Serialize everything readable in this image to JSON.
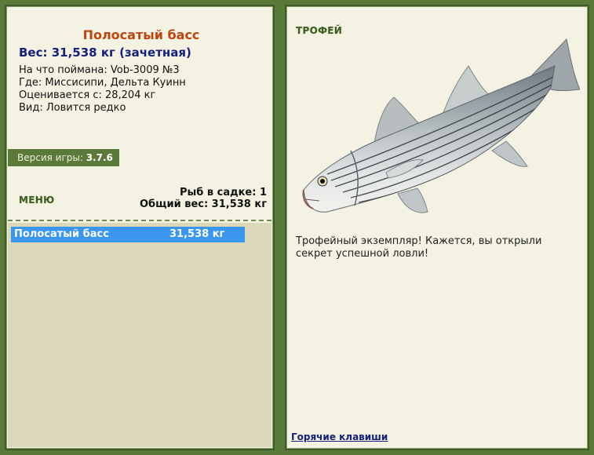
{
  "fish": {
    "title": "Полосатый басс",
    "weight_line": "Вес: 31,538 кг (зачетная)",
    "bait_line": "На что поймана: Vob-3009 №3",
    "where_line": "Где: Миссисипи, Дельта Куинн",
    "price_line": "Оценивается с: 28,204 кг",
    "kind_line": "Вид: Ловится редко"
  },
  "version": {
    "label": "Версия игры:",
    "value": "3.7.6"
  },
  "menu": {
    "label": "МЕНЮ"
  },
  "keep": {
    "count_line": "Рыб в садке: 1",
    "total_line": "Общий вес: 31,538 кг"
  },
  "keep_list": [
    {
      "name": "Полосатый басс",
      "weight": "31,538 кг"
    }
  ],
  "trophy": {
    "title": "ТРОФЕЙ",
    "text": "Трофейный экземпляр! Кажется, вы открыли секрет успешной ловли!"
  },
  "hotkeys": {
    "label": "Горячие клавиши"
  },
  "colors": {
    "background": "#5a7a3a",
    "panel": "#f4f2e2",
    "title": "#c0440e",
    "weight": "#14207a",
    "selection": "#3a96ee"
  },
  "icons": {
    "trophy_fish": "striped-bass-image"
  }
}
